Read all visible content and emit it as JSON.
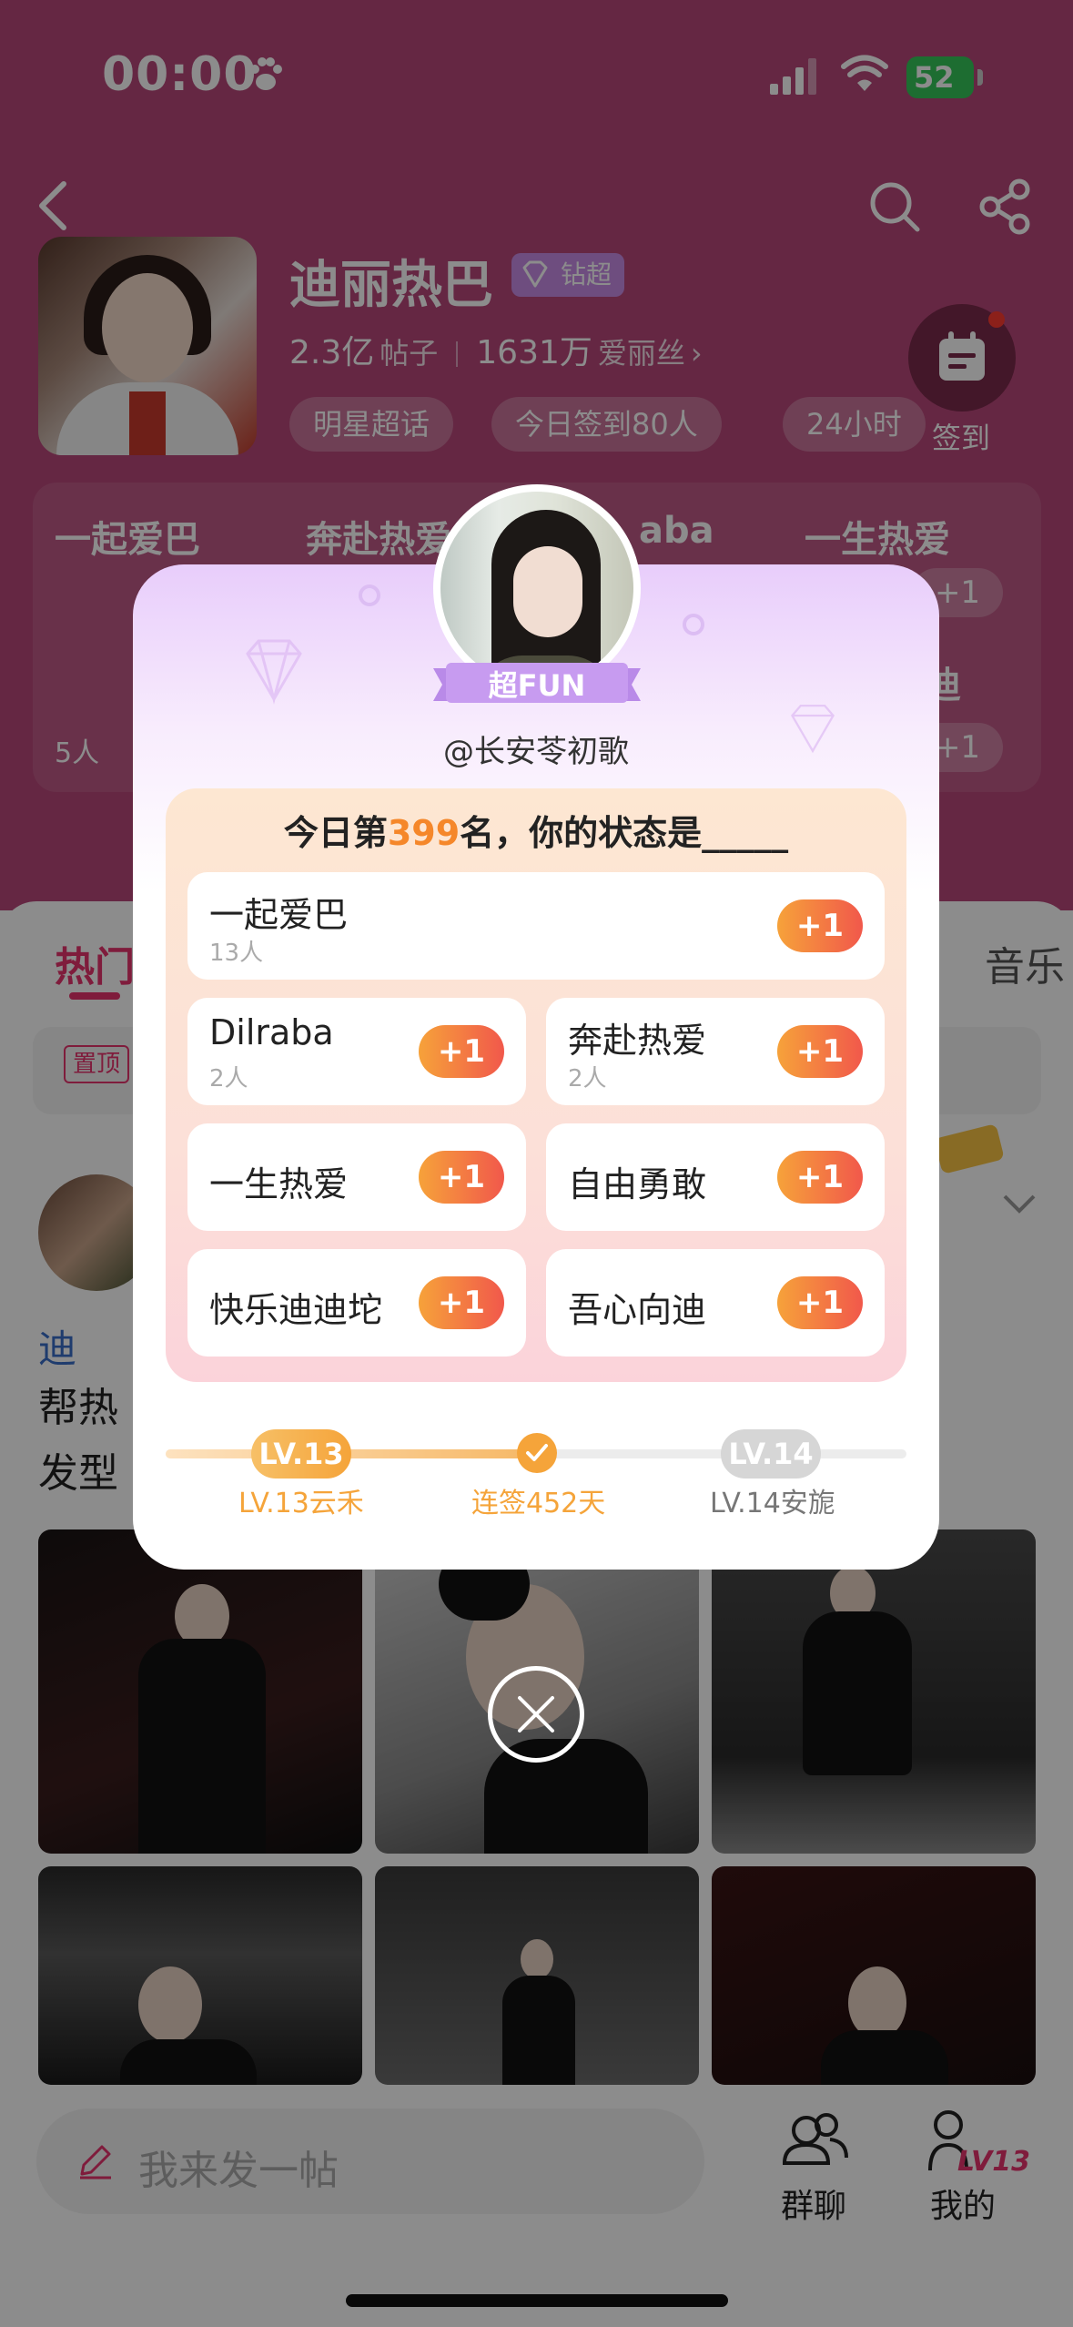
{
  "status_bar": {
    "time": "00:00",
    "battery": "52"
  },
  "topic": {
    "title": "迪丽热巴",
    "badge": "钻超",
    "posts_num": "2.3亿",
    "posts_unit": "帖子",
    "fans_num": "1631万",
    "fans_unit": "爱丽丝",
    "chips": [
      "明星超话",
      "今日签到80人",
      "24小时"
    ],
    "signin_label": "签到"
  },
  "bg_tags": {
    "t1": "一起爱巴",
    "t2": "奔赴热爱",
    "t3": "aba",
    "t4": "一生热爱",
    "t5": "迪",
    "plus1": "+1",
    "plus_small": "+1",
    "count": "5人"
  },
  "feed": {
    "tab_hot": "热门",
    "tab_music": "音乐",
    "pin": "置顶",
    "post_user_prefix": "迪",
    "post_l2": "帮热",
    "post_l3": "发型"
  },
  "modal": {
    "fan_title": "超FUN",
    "handle": "@长安苓初歌",
    "question_prefix": "今日第",
    "question_rank": "399",
    "question_suffix": "名，你的状态是_____",
    "options": [
      {
        "name": "一起爱巴",
        "count": "13人",
        "plus": "+1"
      },
      {
        "name": "Dilraba",
        "count": "2人",
        "plus": "+1"
      },
      {
        "name": "奔赴热爱",
        "count": "2人",
        "plus": "+1"
      },
      {
        "name": "一生热爱",
        "plus": "+1"
      },
      {
        "name": "自由勇敢",
        "plus": "+1"
      },
      {
        "name": "快乐迪迪坨",
        "plus": "+1"
      },
      {
        "name": "吾心向迪",
        "plus": "+1"
      }
    ],
    "level": {
      "current_badge": "LV.13",
      "next_badge": "LV.14",
      "current_label": "LV.13云禾",
      "streak_label": "连签452天",
      "next_label": "LV.14安旎",
      "progress_fraction": 0.5
    }
  },
  "bottom": {
    "compose_placeholder": "我来发一帖",
    "group_chat": "群聊",
    "mine": "我的",
    "mine_level": "LV13"
  },
  "colors": {
    "accent": "#e8336d",
    "orange": "#f5872a",
    "header_bg": "#b8477a"
  }
}
